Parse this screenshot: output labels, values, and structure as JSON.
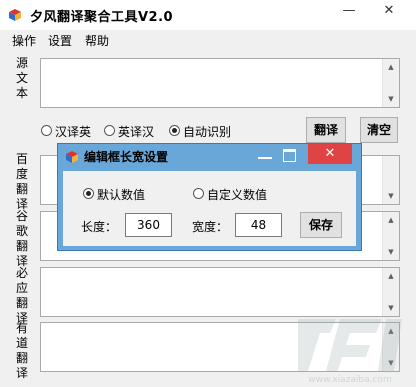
{
  "window": {
    "title": "夕风翻译聚合工具V2.0",
    "minimize": "—",
    "close": "✕"
  },
  "menu": [
    "操作",
    "设置",
    "帮助"
  ],
  "source": {
    "label": "源文本"
  },
  "directions": [
    {
      "label": "汉译英",
      "checked": false
    },
    {
      "label": "英译汉",
      "checked": false
    },
    {
      "label": "自动识别",
      "checked": true
    }
  ],
  "buttons": {
    "translate": "翻译",
    "clear": "清空"
  },
  "outputs": [
    {
      "label": "百度翻译"
    },
    {
      "label": "谷歌翻译"
    },
    {
      "label": "必应翻译"
    },
    {
      "label": "有道翻译"
    }
  ],
  "dialog": {
    "title": "编辑框长宽设置",
    "default_option": "默认数值",
    "custom_option": "自定义数值",
    "length_label": "长度：",
    "length_value": "360",
    "width_label": "宽度：",
    "width_value": "48",
    "save": "保存"
  },
  "watermark": {
    "text": "www.xiazaiba.com"
  },
  "colors": {
    "dialog_frame": "#6aa7d9",
    "close_button": "#e04343"
  }
}
